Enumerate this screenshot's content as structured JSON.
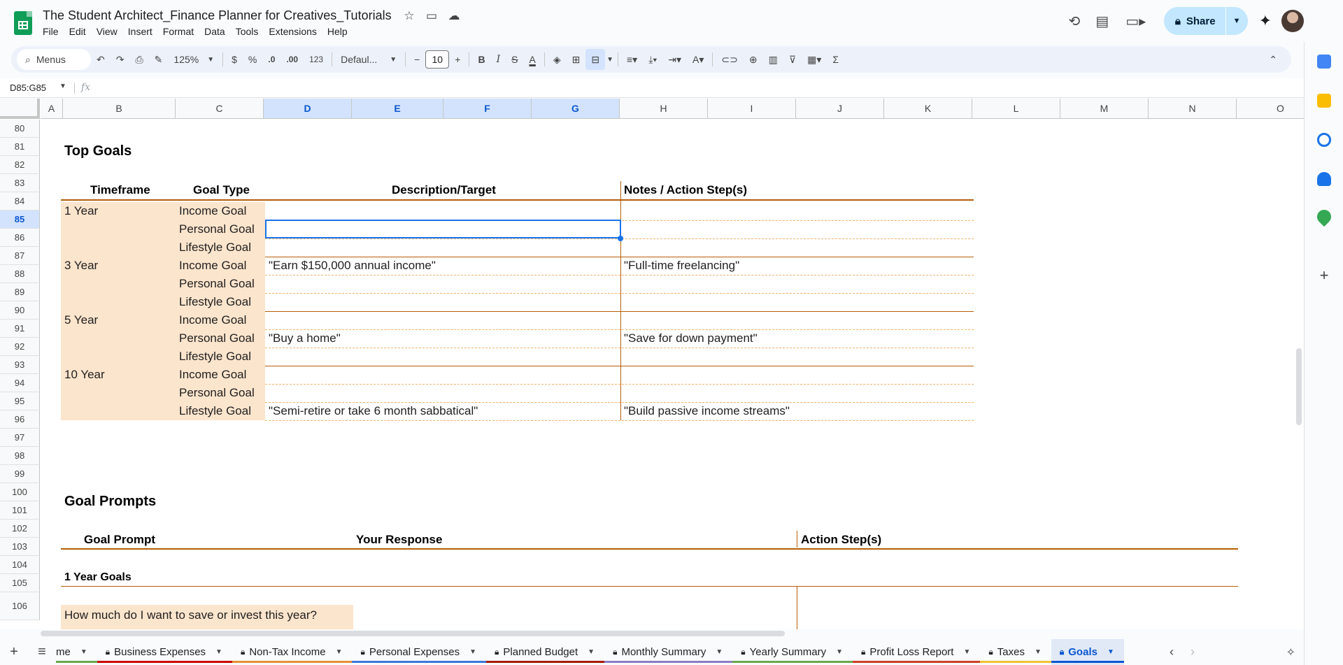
{
  "doc": {
    "title": "The Student Architect_Finance Planner for Creatives_Tutorials"
  },
  "menu": [
    "File",
    "Edit",
    "View",
    "Insert",
    "Format",
    "Data",
    "Tools",
    "Extensions",
    "Help"
  ],
  "share_label": "Share",
  "toolbar": {
    "search_label": "Menus",
    "zoom": "125%",
    "currency": "$",
    "percent": "%",
    "dec_less": ".0",
    "dec_more": ".00",
    "number_format": "123",
    "font": "Defaul...",
    "font_size": "10"
  },
  "formula_bar": {
    "cell_ref": "D85:G85",
    "fx": "fx"
  },
  "columns": [
    "A",
    "B",
    "C",
    "D",
    "E",
    "F",
    "G",
    "H",
    "I",
    "J",
    "K",
    "L",
    "M",
    "N",
    "O"
  ],
  "rows": [
    "80",
    "81",
    "82",
    "83",
    "84",
    "85",
    "86",
    "87",
    "88",
    "89",
    "90",
    "91",
    "92",
    "93",
    "94",
    "95",
    "96",
    "97",
    "98",
    "99",
    "100",
    "101",
    "102",
    "103",
    "104",
    "105",
    "106"
  ],
  "top_goals": {
    "title": "Top Goals",
    "headers": {
      "timeframe": "Timeframe",
      "goal_type": "Goal Type",
      "description": "Description/Target",
      "notes": "Notes / Action Step(s)"
    },
    "groups": [
      {
        "timeframe": "1 Year",
        "goals": [
          {
            "type": "Income Goal",
            "description": "",
            "notes": ""
          },
          {
            "type": "Personal Goal",
            "description": "",
            "notes": ""
          },
          {
            "type": "Lifestyle Goal",
            "description": "",
            "notes": ""
          }
        ]
      },
      {
        "timeframe": "3 Year",
        "goals": [
          {
            "type": "Income Goal",
            "description": "\"Earn $150,000 annual income\"",
            "notes": "\"Full-time freelancing\""
          },
          {
            "type": "Personal Goal",
            "description": "",
            "notes": ""
          },
          {
            "type": "Lifestyle Goal",
            "description": "",
            "notes": ""
          }
        ]
      },
      {
        "timeframe": "5 Year",
        "goals": [
          {
            "type": "Income Goal",
            "description": "",
            "notes": ""
          },
          {
            "type": "Personal Goal",
            "description": "\"Buy a home\"",
            "notes": "\"Save for down payment\""
          },
          {
            "type": "Lifestyle Goal",
            "description": "",
            "notes": ""
          }
        ]
      },
      {
        "timeframe": "10 Year",
        "goals": [
          {
            "type": "Income Goal",
            "description": "",
            "notes": ""
          },
          {
            "type": "Personal Goal",
            "description": "",
            "notes": ""
          },
          {
            "type": "Lifestyle Goal",
            "description": "\"Semi-retire or take 6 month sabbatical\"",
            "notes": "\"Build passive income streams\""
          }
        ]
      }
    ]
  },
  "goal_prompts": {
    "title": "Goal Prompts",
    "headers": {
      "prompt": "Goal Prompt",
      "response": "Your Response",
      "action": "Action Step(s)"
    },
    "section": "1 Year Goals",
    "first_prompt": "How much do I want to save or invest this year?"
  },
  "tabs": [
    {
      "label": "me",
      "locked": false,
      "color": "#6aa84f",
      "active": false
    },
    {
      "label": "Business Expenses",
      "locked": true,
      "color": "#cc0000",
      "active": false
    },
    {
      "label": "Non-Tax Income",
      "locked": true,
      "color": "#e69138",
      "active": false
    },
    {
      "label": "Personal Expenses",
      "locked": true,
      "color": "#3c78d8",
      "active": false
    },
    {
      "label": "Planned Budget",
      "locked": true,
      "color": "#a61c00",
      "active": false
    },
    {
      "label": "Monthly Summary",
      "locked": true,
      "color": "#8e7cc3",
      "active": false
    },
    {
      "label": "Yearly Summary",
      "locked": true,
      "color": "#6aa84f",
      "active": false
    },
    {
      "label": "Profit Loss Report",
      "locked": true,
      "color": "#cc4125",
      "active": false
    },
    {
      "label": "Taxes",
      "locked": true,
      "color": "#f1c232",
      "active": false
    },
    {
      "label": "Goals",
      "locked": true,
      "color": "#0b57d0",
      "active": true
    }
  ]
}
